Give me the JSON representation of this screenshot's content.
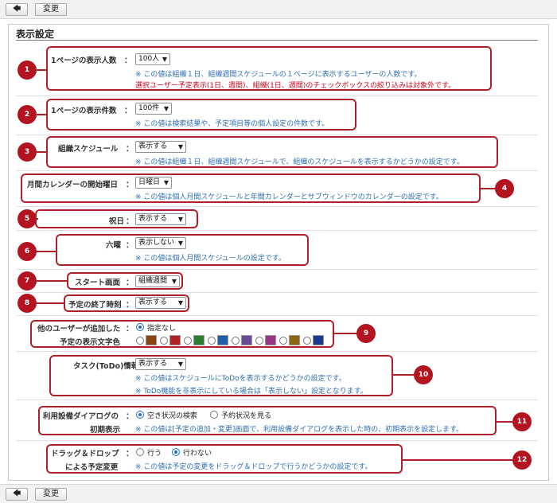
{
  "toolbar": {
    "back_icon": "back-arrow-icon",
    "change_label": "変更"
  },
  "page": {
    "title": "表示設定"
  },
  "settings": {
    "s1": {
      "label": "1ページの表示人数",
      "value": "100人",
      "note1": "※ この値は組織１日、組織週間スケジュールの１ページに表示するユーザーの人数です。",
      "note2": "選択ユーザー予定表示(1日、週間)、組織(1日、週間)のチェックボックスの絞り込みは対象外です。"
    },
    "s2": {
      "label": "1ページの表示件数",
      "value": "100件",
      "note": "※ この値は検索結果や、予定項目等の個人設定の件数です。"
    },
    "s3": {
      "label": "組織スケジュール",
      "value": "表示する",
      "note": "※ この値は組織１日、組織週間スケジュールで、組織のスケジュールを表示するかどうかの設定です。"
    },
    "s4": {
      "label": "月間カレンダーの開始曜日",
      "value": "日曜日",
      "note": "※ この値は個人月間スケジュールと年間カレンダーとサブウィンドウのカレンダーの設定です。"
    },
    "s5": {
      "label": "祝日",
      "value": "表示する"
    },
    "s6": {
      "label": "六曜",
      "value": "表示しない",
      "note": "※ この値は個人月間スケジュールの設定です。"
    },
    "s7": {
      "label": "スタート画面",
      "value": "組織週間"
    },
    "s8": {
      "label": "予定の終了時刻",
      "value": "表示する"
    },
    "s9": {
      "label1": "他のユーザーが追加した",
      "label2": "予定の表示文字色",
      "option_none": "指定なし",
      "colors": [
        "#8b4513",
        "#b22222",
        "#2e7d32",
        "#1f5fa8",
        "#6a4c93",
        "#9c3587",
        "#8b6914",
        "#1a3a8f"
      ]
    },
    "s10": {
      "label": "タスク(ToDo)情報",
      "value": "表示する",
      "note1": "※ この値はスケジュールにToDoを表示するかどうかの設定です。",
      "note2": "※ ToDo機能を非表示にしている場合は「表示しない」設定となります。"
    },
    "s11": {
      "label1": "利用設備ダイアログの",
      "label2": "初期表示",
      "opt1": "空き状況の検索",
      "opt2": "予約状況を見る",
      "note": "※ この値は[予定の追加・変更]画面で、利用設備ダイアログを表示した時の、初期表示を設定します。"
    },
    "s12": {
      "label1": "ドラッグ＆ドロップ",
      "label2": "による予定変更",
      "opt1": "行う",
      "opt2": "行わない",
      "note": "※ この値は予定の変更をドラッグ＆ドロップで行うかどうかの設定です。"
    }
  },
  "colon": "：",
  "badges": [
    "1",
    "2",
    "3",
    "4",
    "5",
    "6",
    "7",
    "8",
    "9",
    "10",
    "11",
    "12"
  ]
}
